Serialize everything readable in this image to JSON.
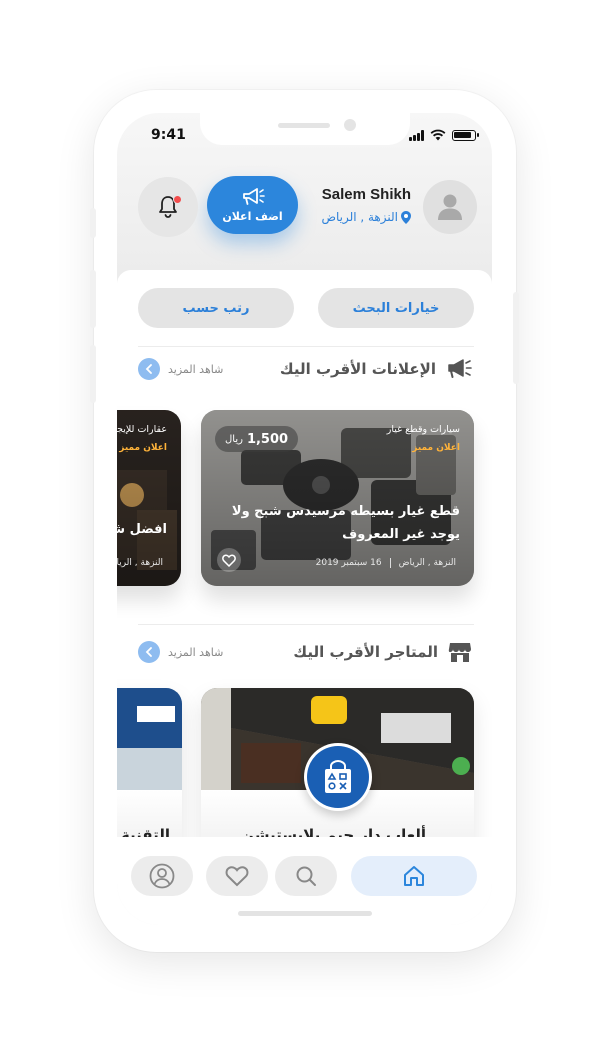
{
  "status_bar": {
    "time": "9:41"
  },
  "header": {
    "user_name": "Salem Shikh",
    "user_location": "النزهة , الرياض",
    "add_ad_label": "اضف اعلان"
  },
  "filters": {
    "search_options": "خيارات البحث",
    "sort_by": "رتب حسب"
  },
  "nearby_ads": {
    "title": "الإعلانات الأقرب اليك",
    "see_more": "شاهد المزيد",
    "items": [
      {
        "category": "سيارات وقطع غيار",
        "featured": "اعلان مميز",
        "price": "1,500",
        "currency": "ريال",
        "title": "قطع غيار بسيطه مرسيدس شبح ولا يوجد غير المعروف",
        "location": "النزهة , الرياض",
        "date": "16  سبتمبر 2019"
      },
      {
        "category": "عقارات للإيجار",
        "featured": "اعلان مميز",
        "title": "افضل شقة",
        "location": "النزهة , الرياض"
      }
    ]
  },
  "nearby_stores": {
    "title": "المتاجر الأقرب اليك",
    "see_more": "شاهد المزيد",
    "items": [
      {
        "name": "ألعاب دار جيم بلايستيشن"
      },
      {
        "name": "التقنية"
      }
    ]
  },
  "tab_bar": {
    "tabs": [
      "home",
      "search",
      "favorites",
      "profile"
    ],
    "active": "home"
  },
  "colors": {
    "accent": "#2c86dc",
    "featured": "#ffb33a",
    "notification_dot": "#f24d4d"
  }
}
